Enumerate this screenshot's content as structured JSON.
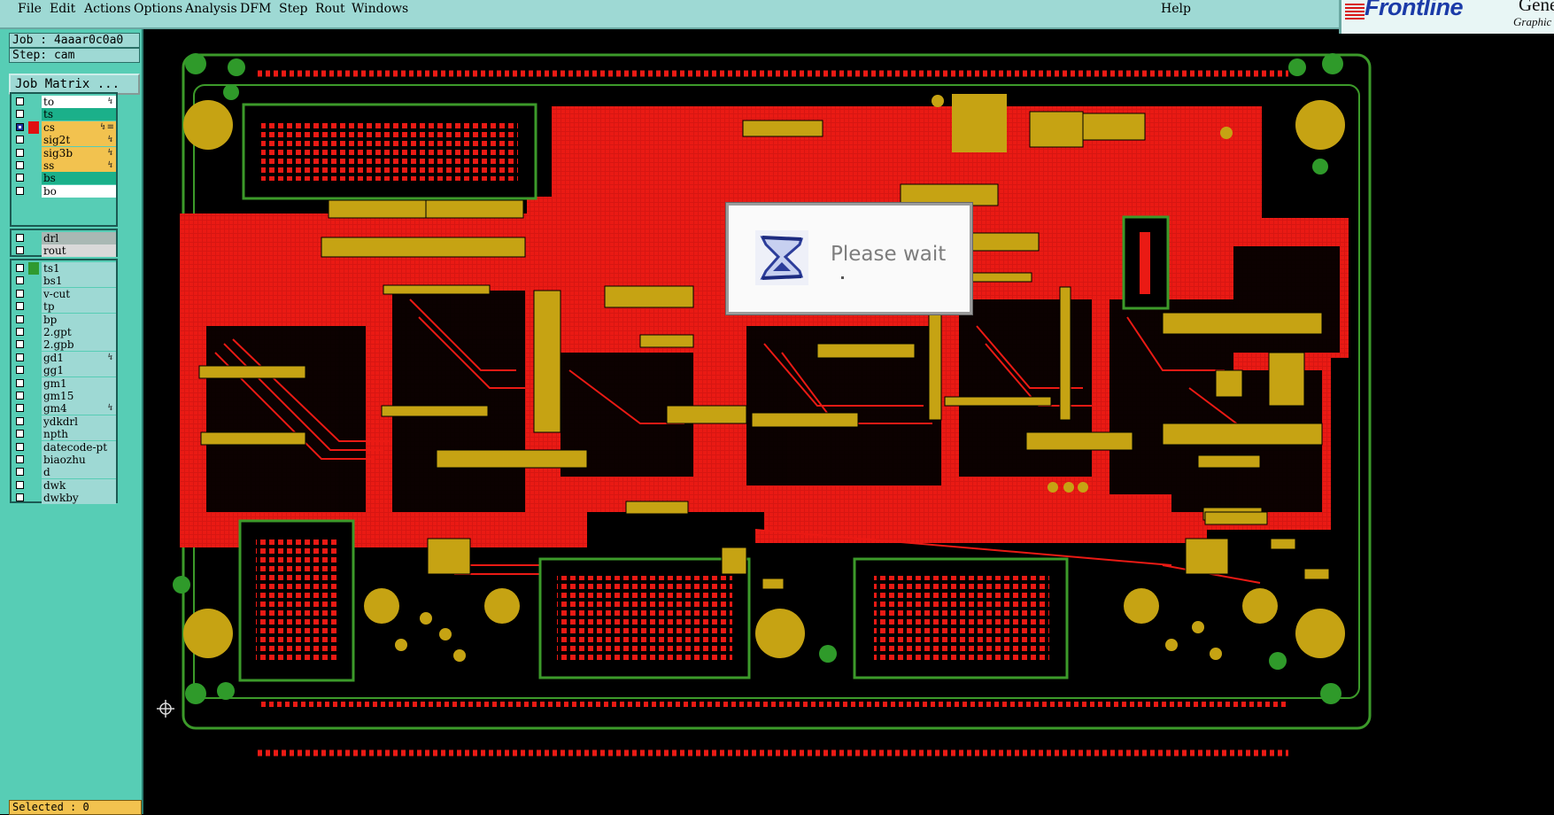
{
  "menubar": {
    "items": [
      "File",
      "Edit",
      "Actions",
      "Options",
      "Analysis",
      "DFM",
      "Step",
      "Rout",
      "Windows"
    ],
    "help": "Help"
  },
  "logo": {
    "brand": "Frontline",
    "product": "Genesis",
    "subtitle": "Graphic"
  },
  "job": {
    "label": "Job : 4aaar0c0a0",
    "step": "Step: cam",
    "matrix_button": "Job Matrix ..."
  },
  "layers": {
    "board": [
      {
        "name": "to",
        "color": "#ffffff",
        "mark": "",
        "flag": "↯"
      },
      {
        "name": "ts",
        "color": "#1bb08a",
        "mark": "",
        "flag": ""
      },
      {
        "name": "cs",
        "color": "#f2c24f",
        "mark": "#e01010",
        "flag": "↯≡",
        "checked": true
      },
      {
        "name": "sig2t",
        "color": "#f2c24f",
        "mark": "",
        "flag": "↯"
      },
      {
        "name": "sig3b",
        "color": "#f2c24f",
        "mark": "",
        "flag": "↯"
      },
      {
        "name": "ss",
        "color": "#f2c24f",
        "mark": "",
        "flag": "↯"
      },
      {
        "name": "bs",
        "color": "#1bb08a",
        "mark": "",
        "flag": ""
      },
      {
        "name": "bo",
        "color": "#ffffff",
        "mark": "",
        "flag": ""
      }
    ],
    "drill": [
      {
        "name": "drl",
        "color": "#a9b8b4",
        "mark": "",
        "flag": ""
      },
      {
        "name": "rout",
        "color": "#d9d9d9",
        "mark": "",
        "flag": ""
      }
    ],
    "misc": [
      {
        "name": "ts1",
        "color": "#9ed9d4",
        "mark": "#2f9a2f",
        "flag": ""
      },
      {
        "name": "bs1",
        "color": "#9ed9d4",
        "mark": "",
        "flag": ""
      },
      {
        "name": "v-cut",
        "color": "#9ed9d4",
        "mark": "",
        "flag": ""
      },
      {
        "name": "tp",
        "color": "#9ed9d4",
        "mark": "",
        "flag": ""
      },
      {
        "name": "bp",
        "color": "#9ed9d4",
        "mark": "",
        "flag": ""
      },
      {
        "name": "2.gpt",
        "color": "#9ed9d4",
        "mark": "",
        "flag": ""
      },
      {
        "name": "2.gpb",
        "color": "#9ed9d4",
        "mark": "",
        "flag": ""
      },
      {
        "name": "gd1",
        "color": "#9ed9d4",
        "mark": "",
        "flag": "↯"
      },
      {
        "name": "gg1",
        "color": "#9ed9d4",
        "mark": "",
        "flag": ""
      },
      {
        "name": "gm1",
        "color": "#9ed9d4",
        "mark": "",
        "flag": ""
      },
      {
        "name": "gm15",
        "color": "#9ed9d4",
        "mark": "",
        "flag": ""
      },
      {
        "name": "gm4",
        "color": "#9ed9d4",
        "mark": "",
        "flag": "↯"
      },
      {
        "name": "ydkdrl",
        "color": "#9ed9d4",
        "mark": "",
        "flag": ""
      },
      {
        "name": "npth",
        "color": "#9ed9d4",
        "mark": "",
        "flag": ""
      },
      {
        "name": "datecode-pt",
        "color": "#9ed9d4",
        "mark": "",
        "flag": ""
      },
      {
        "name": "biaozhu",
        "color": "#9ed9d4",
        "mark": "",
        "flag": ""
      },
      {
        "name": "d",
        "color": "#9ed9d4",
        "mark": "",
        "flag": ""
      },
      {
        "name": "dwk",
        "color": "#9ed9d4",
        "mark": "",
        "flag": ""
      },
      {
        "name": "dwkby",
        "color": "#9ed9d4",
        "mark": "",
        "flag": ""
      }
    ]
  },
  "status": {
    "selected": "Selected : 0"
  },
  "dialog": {
    "message": "Please wait"
  },
  "colors": {
    "copper": "#ea1a14",
    "pad": "#c6a313",
    "outline": "#3c9a2a",
    "background": "#000000",
    "menubar": "#9ed9d4",
    "panel": "#57cdb5"
  }
}
